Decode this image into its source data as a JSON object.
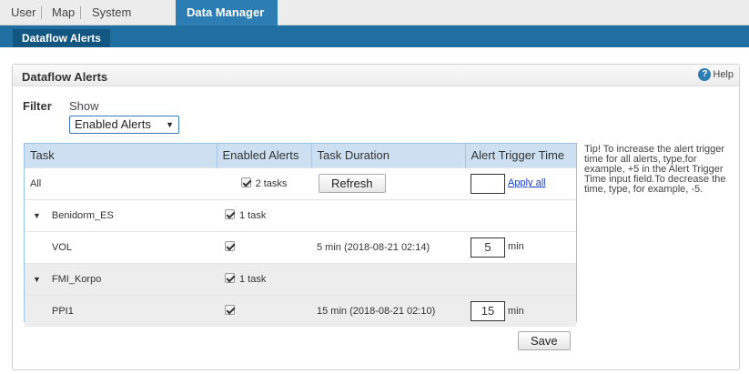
{
  "topnav": {
    "tabs": [
      {
        "label": "User"
      },
      {
        "label": "Map"
      },
      {
        "label": "System"
      },
      {
        "label": "Data Manager",
        "active": true
      }
    ]
  },
  "subnav": {
    "active_tab": "Dataflow Alerts"
  },
  "panel": {
    "title": "Dataflow Alerts",
    "help_label": "Help",
    "filter_label": "Filter",
    "show_label": "Show",
    "show_select_value": "Enabled Alerts"
  },
  "table": {
    "headers": [
      "Task",
      "Enabled Alerts",
      "Task Duration",
      "Alert Trigger Time"
    ],
    "all_row": {
      "task": "All",
      "enabled": "2 tasks",
      "refresh_label": "Refresh",
      "trigger_value": "",
      "apply_all_label": "Apply all"
    },
    "groups": [
      {
        "name": "Benidorm_ES",
        "enabled": "1 task",
        "tasks": [
          {
            "name": "VOL",
            "duration": "5 min (2018-08-21 02:14)",
            "trigger": "5",
            "unit": "min"
          }
        ]
      },
      {
        "name": "FMI_Korpo",
        "enabled": "1 task",
        "tasks": [
          {
            "name": "PPI1",
            "duration": "15 min (2018-08-21 02:10)",
            "trigger": "15",
            "unit": "min"
          }
        ]
      }
    ]
  },
  "tip": "Tip! To increase the alert trigger time for all alerts, type,for example, +5 in the Alert Trigger Time input field.To decrease the time, type, for example, -5.",
  "save_label": "Save",
  "colors": {
    "nav_active": "#2c7db4",
    "subnav": "#1f6fa3",
    "header_row": "#cde0f2",
    "link": "#1a3cc4"
  }
}
